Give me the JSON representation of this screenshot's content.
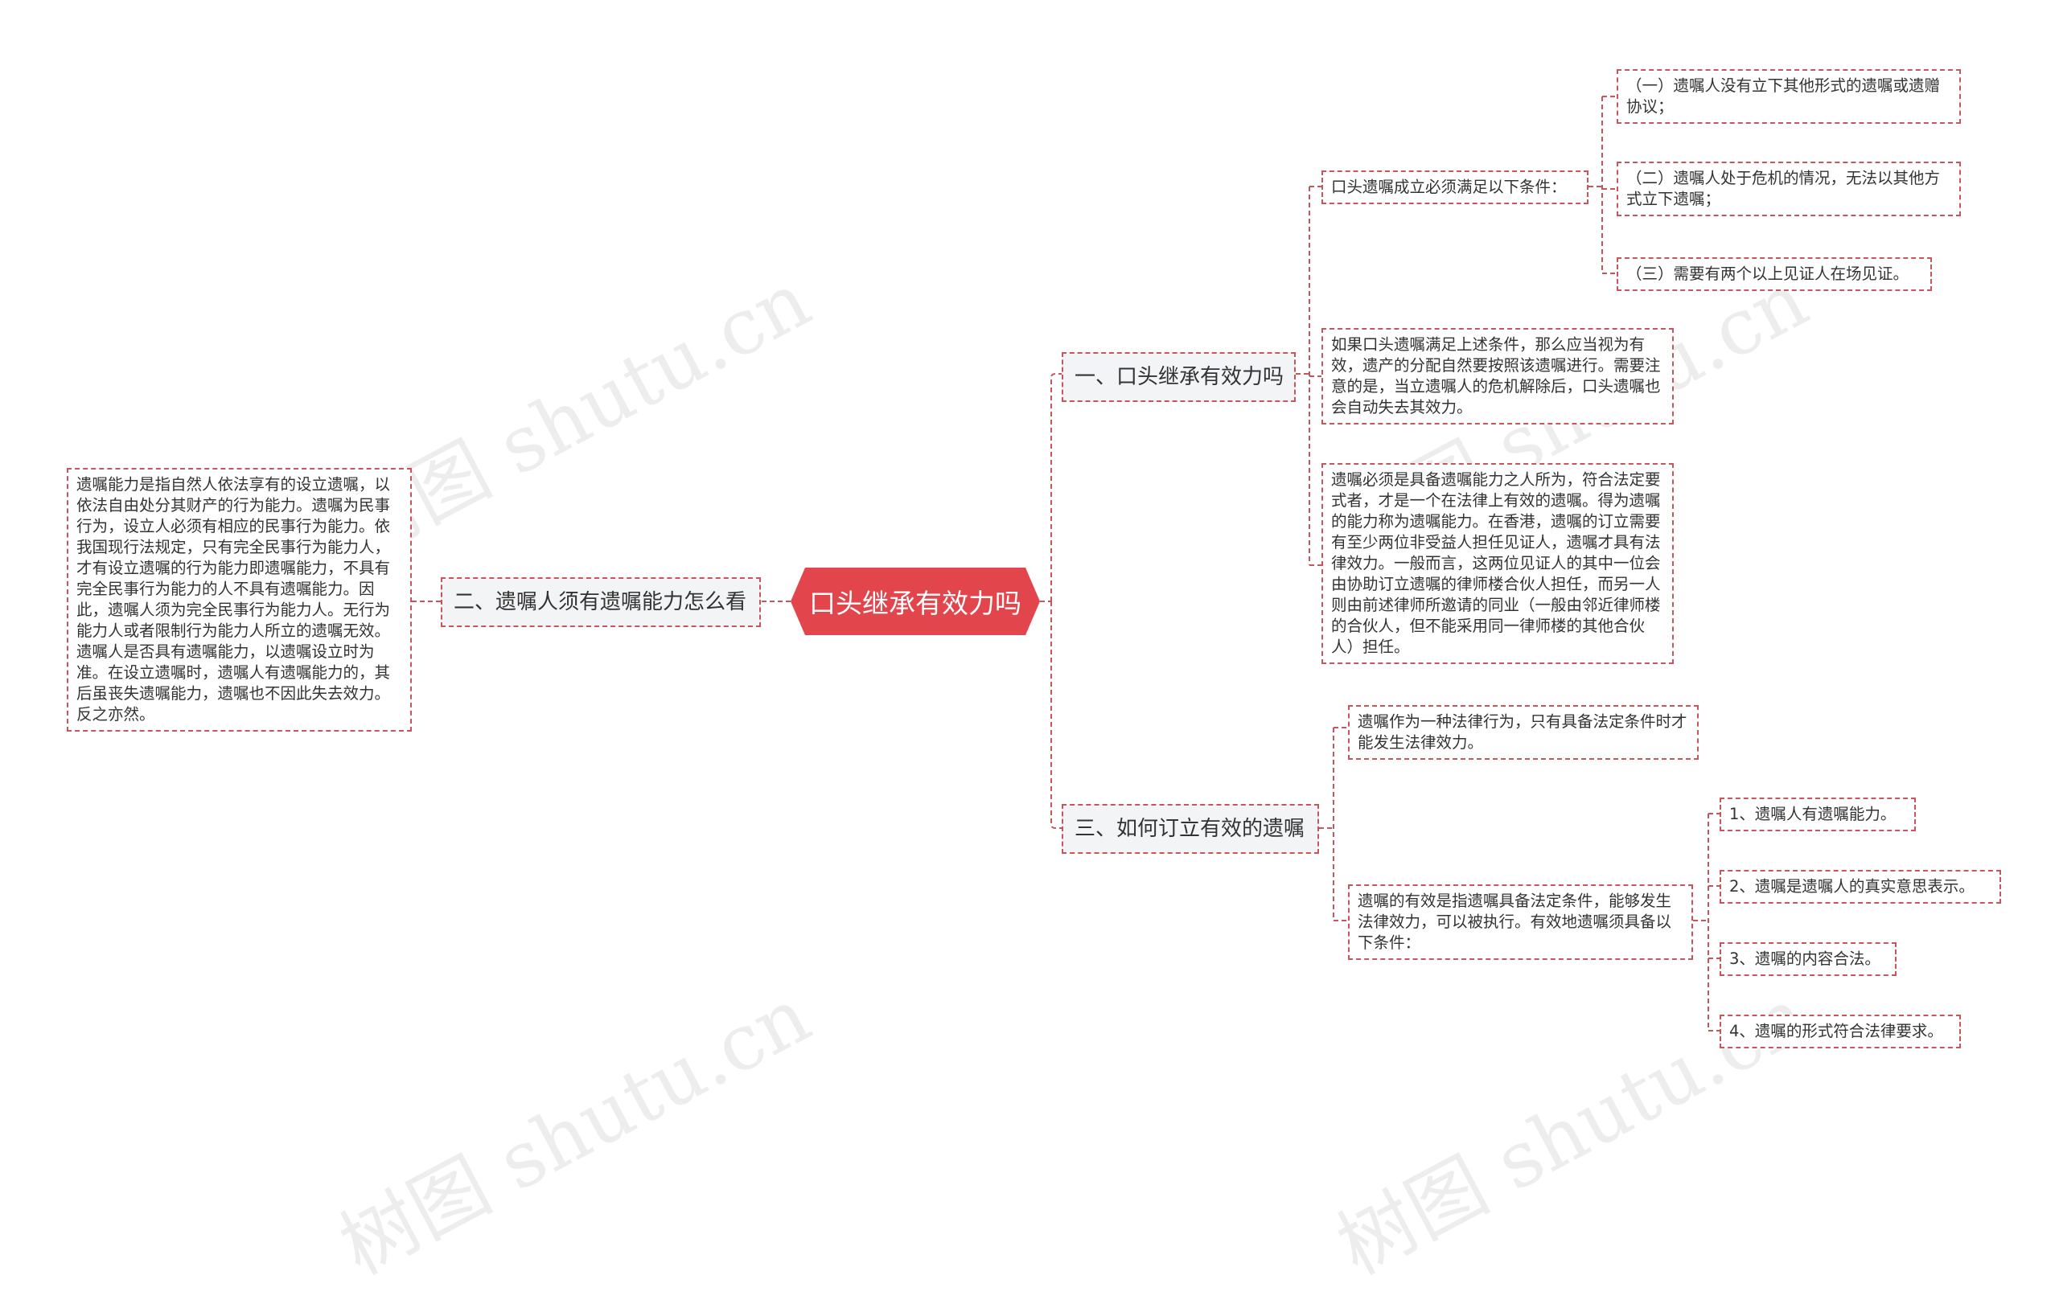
{
  "root": {
    "label": "口头继承有效力吗"
  },
  "branches": [
    {
      "label": "一、口头继承有效力吗",
      "children": [
        {
          "text": "口头遗嘱成立必须满足以下条件：",
          "children": [
            "（一）遗嘱人没有立下其他形式的遗嘱或遗赠协议；",
            "（二）遗嘱人处于危机的情况，无法以其他方式立下遗嘱；",
            "（三）需要有两个以上见证人在场见证。"
          ]
        },
        {
          "text": "如果口头遗嘱满足上述条件，那么应当视为有效，遗产的分配自然要按照该遗嘱进行。需要注意的是，当立遗嘱人的危机解除后，口头遗嘱也会自动失去其效力。"
        },
        {
          "text": "遗嘱必须是具备遗嘱能力之人所为，符合法定要式者，才是一个在法律上有效的遗嘱。得为遗嘱的能力称为遗嘱能力。在香港，遗嘱的订立需要有至少两位非受益人担任见证人，遗嘱才具有法律效力。一般而言，这两位见证人的其中一位会由协助订立遗嘱的律师楼合伙人担任，而另一人则由前述律师所邀请的同业（一般由邻近律师楼的合伙人，但不能采用同一律师楼的其他合伙人）担任。"
        }
      ]
    },
    {
      "label": "二、遗嘱人须有遗嘱能力怎么看",
      "children": [
        {
          "text": "遗嘱能力是指自然人依法享有的设立遗嘱，以依法自由处分其财产的行为能力。遗嘱为民事行为，设立人必须有相应的民事行为能力。依我国现行法规定，只有完全民事行为能力人，才有设立遗嘱的行为能力即遗嘱能力，不具有完全民事行为能力的人不具有遗嘱能力。因此，遗嘱人须为完全民事行为能力人。无行为能力人或者限制行为能力人所立的遗嘱无效。遗嘱人是否具有遗嘱能力，以遗嘱设立时为准。在设立遗嘱时，遗嘱人有遗嘱能力的，其后虽丧失遗嘱能力，遗嘱也不因此失去效力。反之亦然。"
        }
      ]
    },
    {
      "label": "三、如何订立有效的遗嘱",
      "children": [
        {
          "text": "遗嘱作为一种法律行为，只有具备法定条件时才能发生法律效力。"
        },
        {
          "text": "遗嘱的有效是指遗嘱具备法定条件，能够发生法律效力，可以被执行。有效地遗嘱须具备以下条件：",
          "children": [
            "1、遗嘱人有遗嘱能力。",
            "2、遗嘱是遗嘱人的真实意思表示。",
            "3、遗嘱的内容合法。",
            "4、遗嘱的形式符合法律要求。"
          ]
        }
      ]
    }
  ],
  "watermark": "树图 shutu.cn",
  "colors": {
    "accent": "#e2454b",
    "line": "#c7565c",
    "node_bg": "#f3f4f6"
  }
}
